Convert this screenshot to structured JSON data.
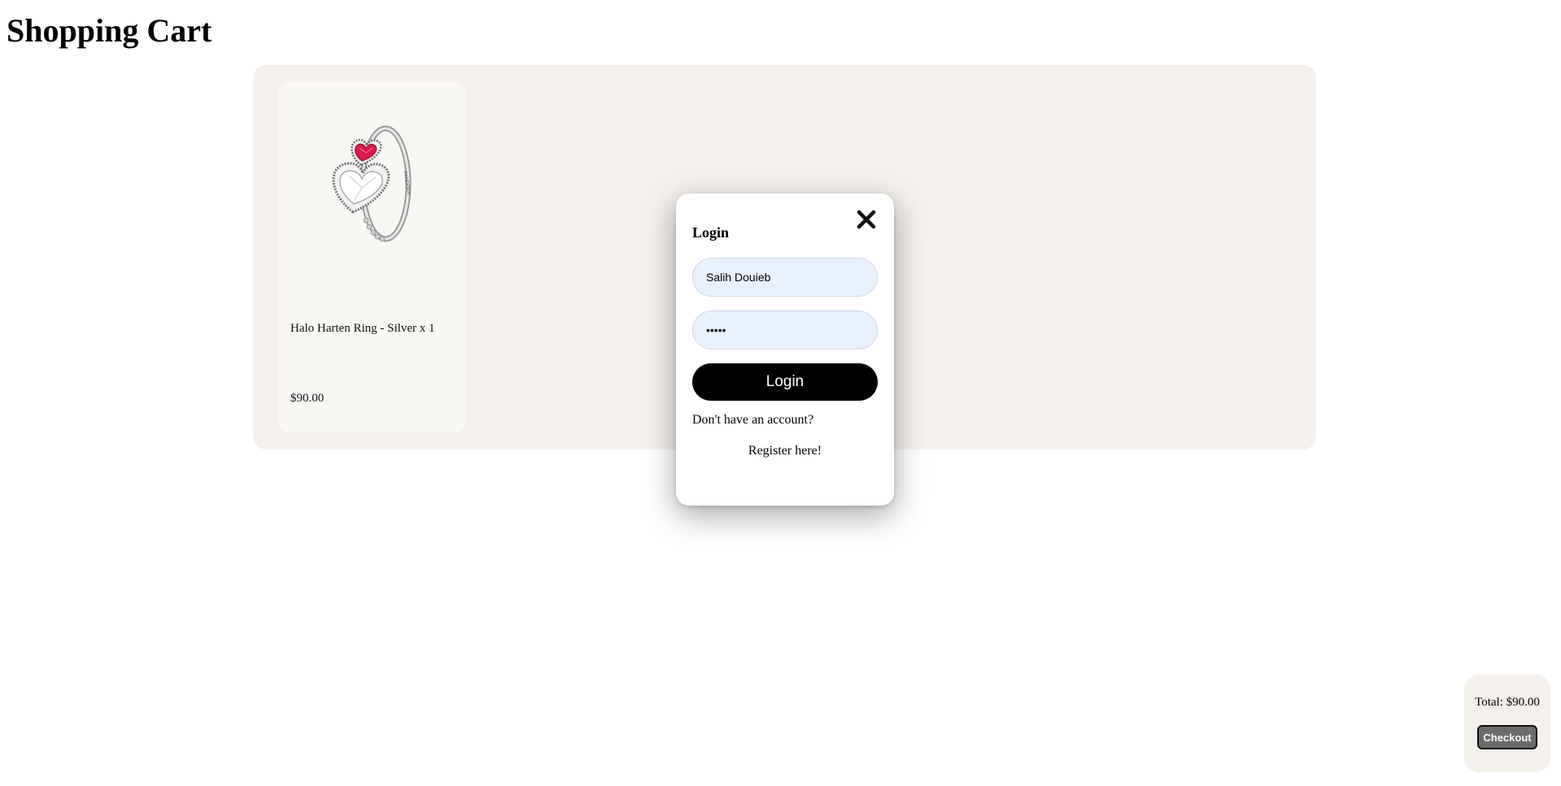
{
  "page": {
    "title": "Shopping Cart"
  },
  "cart": {
    "items": [
      {
        "name": "Halo Harten Ring - Silver x 1",
        "price": "$90.00",
        "image_icon": "heart-ring-image"
      }
    ]
  },
  "login_modal": {
    "title": "Login",
    "username_value": "Salih Douieb",
    "password_value": "•••••",
    "login_button": "Login",
    "no_account_text": "Don't have an account?",
    "register_link": "Register here!",
    "close_icon": "close-icon"
  },
  "summary": {
    "total": "Total: $90.00",
    "checkout_button": "Checkout"
  },
  "colors": {
    "panel_bg": "#f4f0eb",
    "card_bg": "#f8f7f4",
    "input_bg": "#e8f0fe",
    "login_button_bg": "#000000",
    "checkout_bg": "#6b6b6b",
    "gem_red": "#d81b4a"
  }
}
